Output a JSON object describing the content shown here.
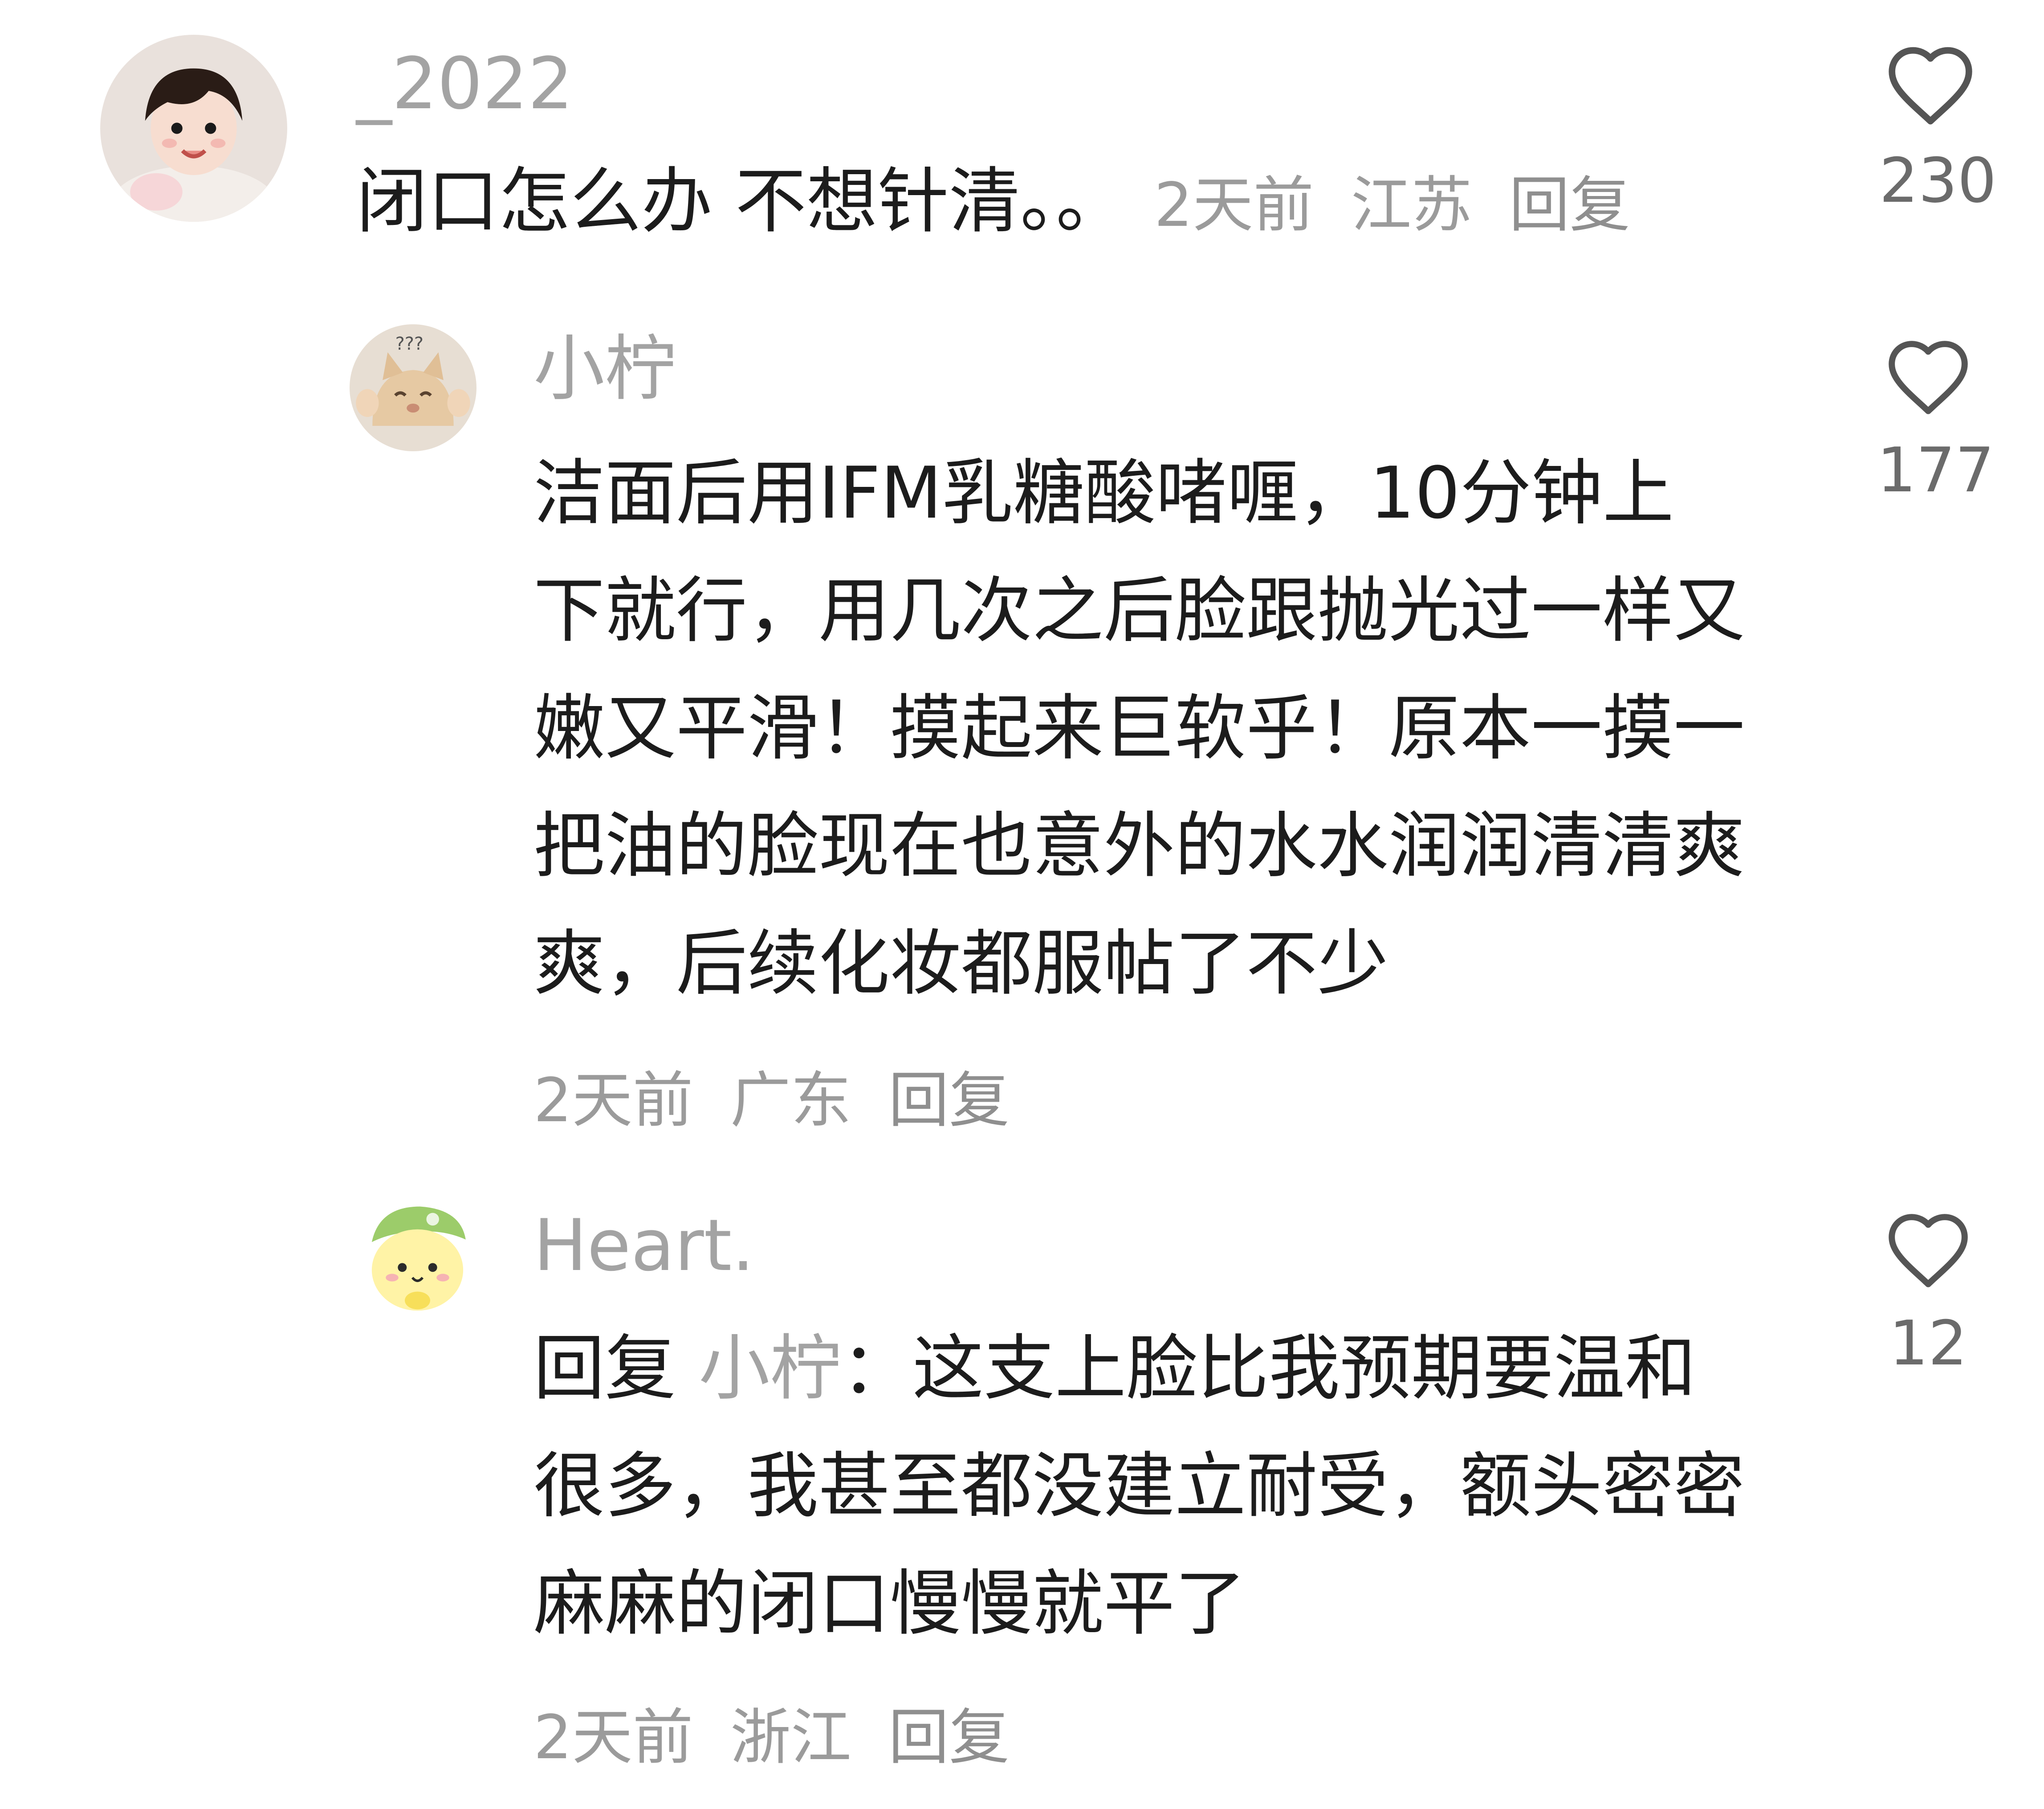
{
  "comments": [
    {
      "username": "_2022",
      "text": "闭口怎么办 不想针清。。",
      "time": "2天前",
      "location": "江苏",
      "reply_label": "回复",
      "likes": "230",
      "avatar_icon": "baby-photo-avatar"
    }
  ],
  "replies": [
    {
      "username": "小柠",
      "text": "洁面后用IFM乳糖酸啫喱，10分钟上下就行，用几次之后脸跟抛光过一样又嫩又平滑！摸起来巨软乎！原本一摸一把油的脸现在也意外的水水润润清清爽爽，后续化妆都服帖了不少",
      "time": "2天前",
      "location": "广东",
      "reply_label": "回复",
      "likes": "177",
      "avatar_icon": "cat-avatar"
    },
    {
      "username": "Heart.",
      "reply_prefix": "回复",
      "reply_target": "小柠",
      "reply_colon": "：",
      "text": "这支上脸比我预期要温和很多，我甚至都没建立耐受，额头密密麻麻的闭口慢慢就平了",
      "time": "2天前",
      "location": "浙江",
      "reply_label": "回复",
      "likes": "12",
      "avatar_icon": "lemon-cartoon-avatar"
    }
  ]
}
